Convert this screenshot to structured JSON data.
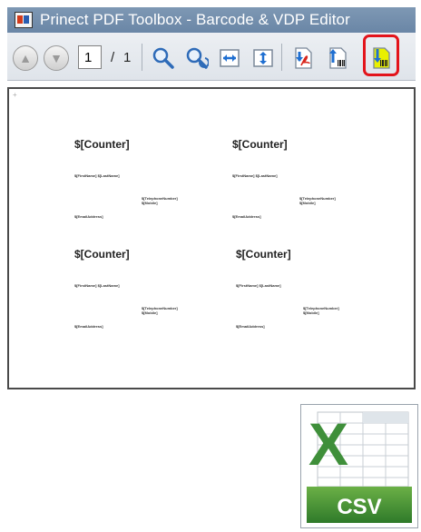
{
  "window": {
    "title": "Prinect PDF Toolbox - Barcode & VDP Editor"
  },
  "toolbar": {
    "page_current": "1",
    "page_separator": "/",
    "page_total": "1"
  },
  "document": {
    "cards": [
      {
        "counter": "$[Counter]",
        "name": "$[FirstName] $[LastName]",
        "phone": "$[TelephoneNumber]",
        "mobile": "$[Mobile]",
        "email": "$[EmailAddress]"
      },
      {
        "counter": "$[Counter]",
        "name": "$[FirstName] $[LastName]",
        "phone": "$[TelephoneNumber]",
        "mobile": "$[Mobile]",
        "email": "$[EmailAddress]"
      },
      {
        "counter": "$[Counter]",
        "name": "$[FirstName] $[LastName]",
        "phone": "$[TelephoneNumber]",
        "mobile": "$[Mobile]",
        "email": "$[EmailAddress]"
      },
      {
        "counter": "$[Counter]",
        "name": "$[FirstName] $[LastName]",
        "phone": "$[TelephoneNumber]",
        "mobile": "$[Mobile]",
        "email": "$[EmailAddress]"
      }
    ]
  },
  "csv_icon": {
    "label": "CSV",
    "letter": "X",
    "brand_color": "#3f8f3a"
  },
  "colors": {
    "highlight": "#e3141b",
    "accent_blue": "#1f6fd1",
    "icon_yellow": "#e9f000"
  },
  "icons": [
    "app-icon",
    "arrow-up-icon",
    "arrow-down-icon",
    "zoom-icon",
    "zoom-refresh-icon",
    "fit-width-icon",
    "fit-height-icon",
    "pdf-icon",
    "barcode-import-icon",
    "barcode-export-icon",
    "csv-file-icon"
  ]
}
